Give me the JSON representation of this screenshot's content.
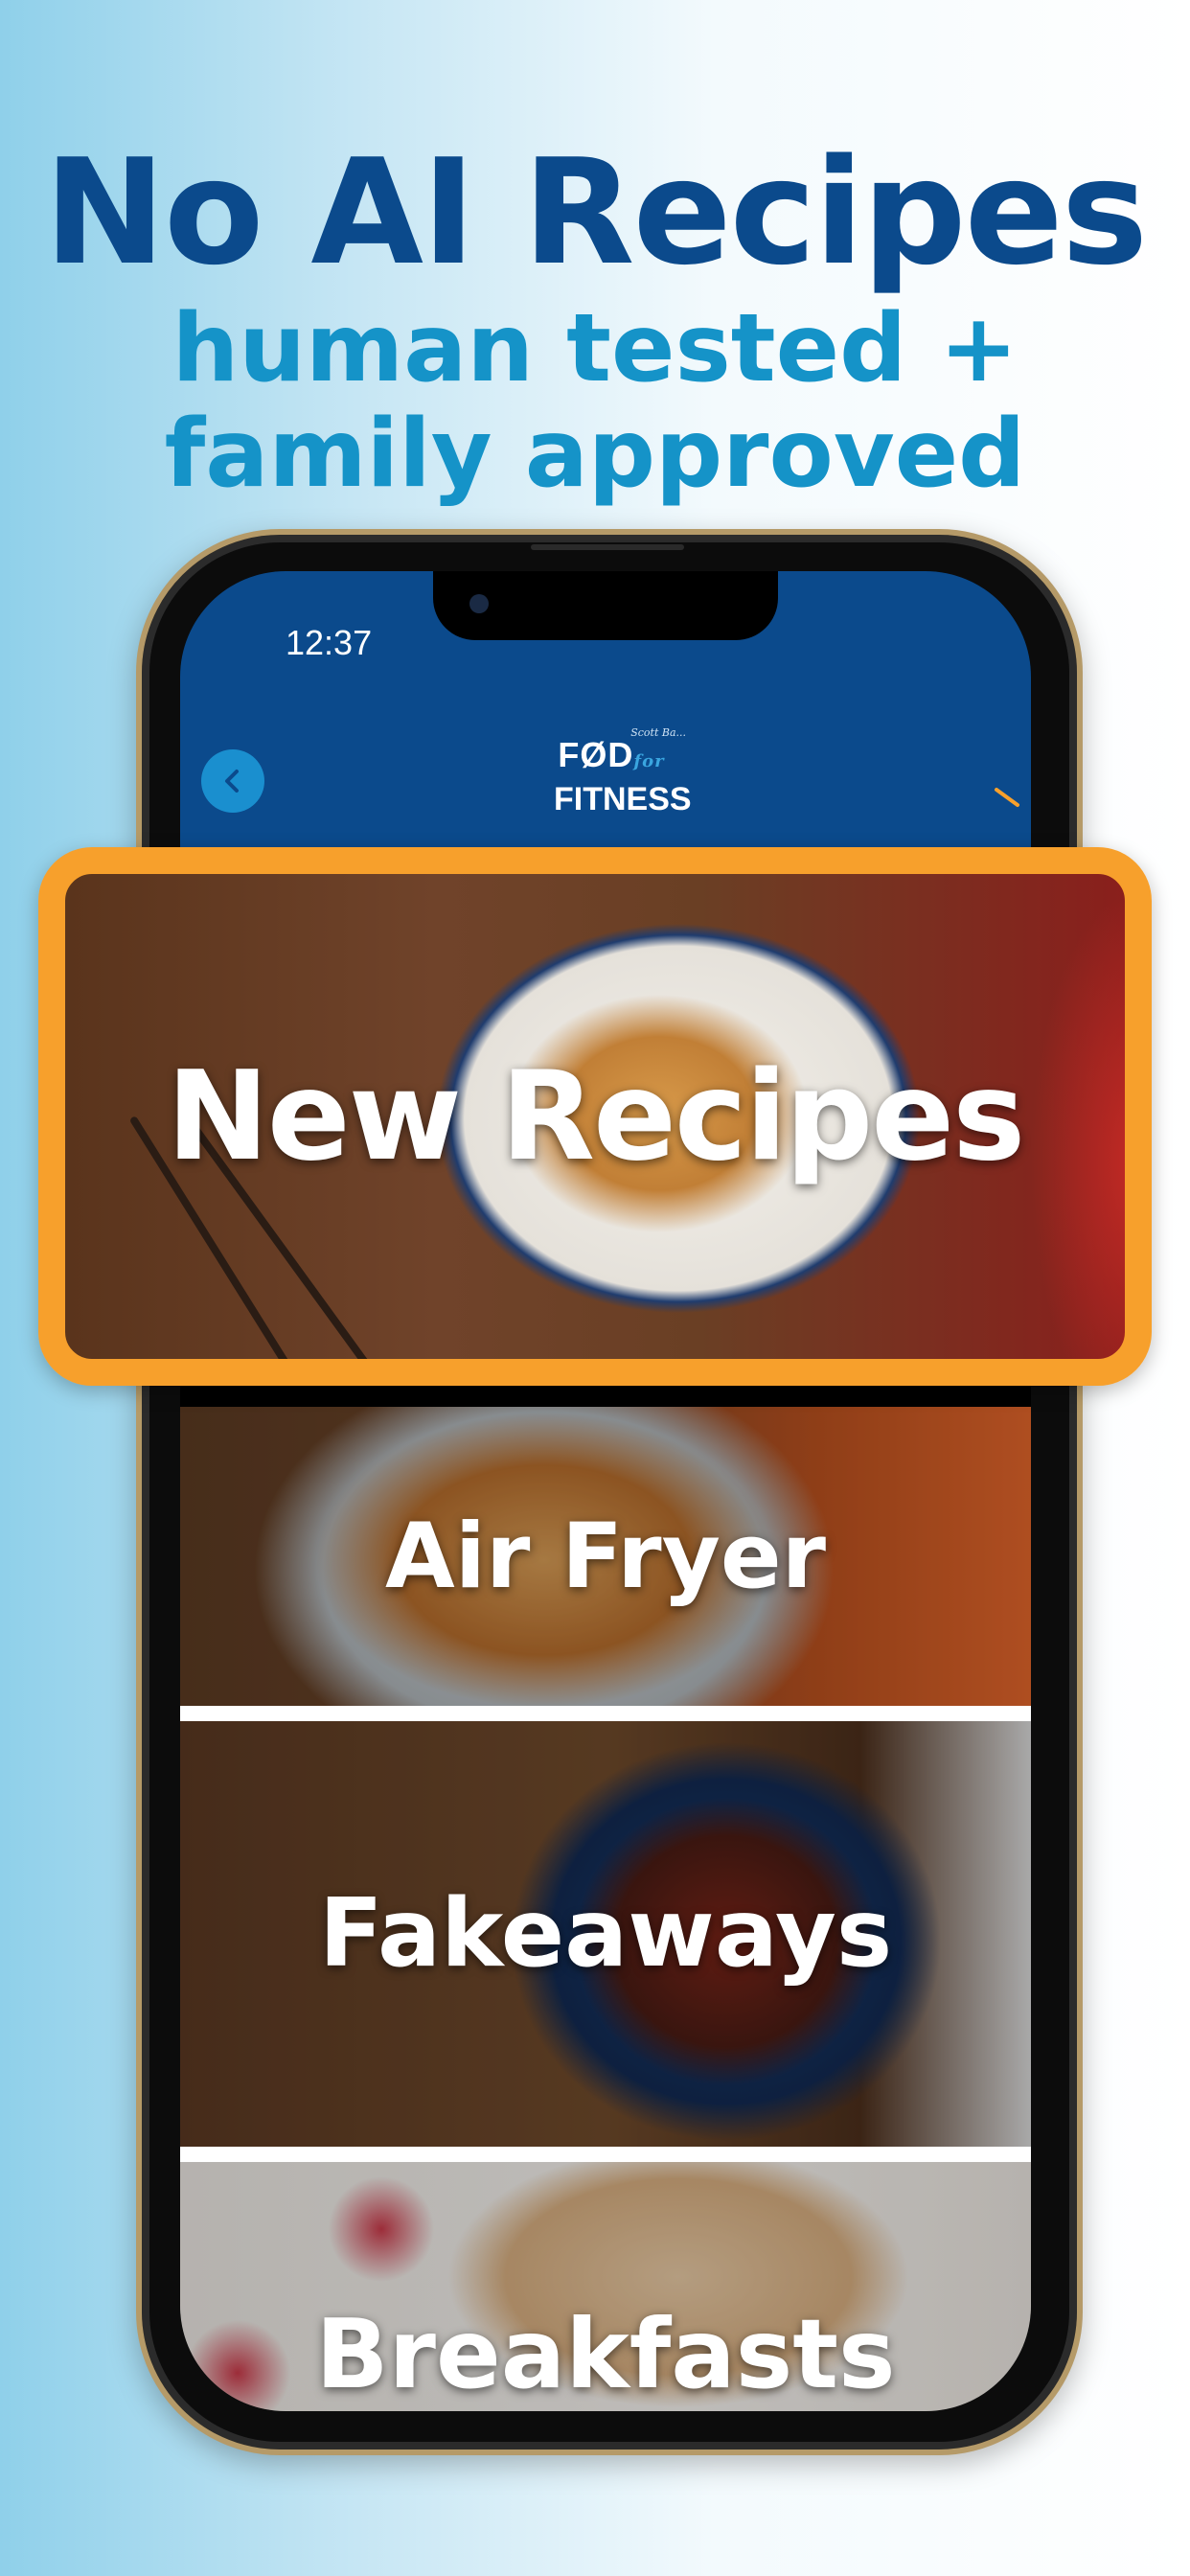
{
  "promo": {
    "headline": "No AI Recipes",
    "subline_1": "human tested +",
    "subline_2": "family approved"
  },
  "status_bar": {
    "time": "12:37"
  },
  "app_header": {
    "logo_line_1": "FØD",
    "logo_for": "for",
    "logo_line_2": "FITNESS",
    "logo_script": "Scott Ba..."
  },
  "categories": [
    {
      "label": "New Recipes",
      "highlighted": true
    },
    {
      "label": "Air Fryer"
    },
    {
      "label": "Fakeaways"
    },
    {
      "label": "Breakfasts"
    }
  ],
  "colors": {
    "brand_navy": "#0b4a8c",
    "brand_blue": "#1593c8",
    "highlight_orange": "#f7a02c"
  }
}
